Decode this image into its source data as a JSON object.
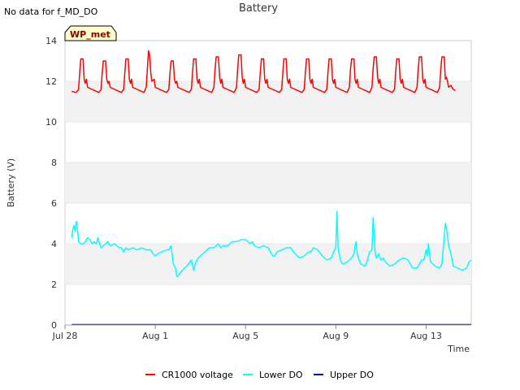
{
  "header": {
    "no_data_note": "No data for f_MD_DO",
    "badge_label": "WP_met"
  },
  "chart_data": {
    "type": "line",
    "title": "Battery",
    "xlabel": "Time",
    "ylabel": "Battery (V)",
    "x_unit": "days",
    "x_range": [
      "Jul 28",
      "Aug 15"
    ],
    "xlim": [
      0,
      18
    ],
    "ylim": [
      0,
      14
    ],
    "y_ticks": [
      0,
      2,
      4,
      6,
      8,
      10,
      12,
      14
    ],
    "x_ticks": [
      {
        "value": 0,
        "label": "Jul 28"
      },
      {
        "value": 4,
        "label": "Aug 1"
      },
      {
        "value": 8,
        "label": "Aug 5"
      },
      {
        "value": 12,
        "label": "Aug 9"
      },
      {
        "value": 16,
        "label": "Aug 13"
      }
    ],
    "grid": "horizontal alternating bands",
    "legend_position": "bottom",
    "series": [
      {
        "name": "CR1000 voltage",
        "color": "#ff0000",
        "points": [
          [
            0.3,
            11.5
          ],
          [
            0.5,
            11.45
          ],
          [
            0.6,
            11.6
          ],
          [
            0.65,
            12.4
          ],
          [
            0.7,
            13.1
          ],
          [
            0.8,
            13.1
          ],
          [
            0.85,
            12.1
          ],
          [
            0.9,
            11.9
          ],
          [
            0.95,
            12.1
          ],
          [
            1.0,
            11.7
          ],
          [
            1.2,
            11.6
          ],
          [
            1.5,
            11.45
          ],
          [
            1.6,
            11.6
          ],
          [
            1.65,
            12.4
          ],
          [
            1.7,
            13.0
          ],
          [
            1.8,
            13.0
          ],
          [
            1.85,
            12.1
          ],
          [
            1.9,
            11.9
          ],
          [
            1.95,
            12.0
          ],
          [
            2.0,
            11.7
          ],
          [
            2.2,
            11.6
          ],
          [
            2.5,
            11.45
          ],
          [
            2.6,
            11.6
          ],
          [
            2.65,
            12.4
          ],
          [
            2.7,
            13.1
          ],
          [
            2.8,
            13.1
          ],
          [
            2.85,
            12.1
          ],
          [
            2.9,
            11.9
          ],
          [
            2.95,
            12.1
          ],
          [
            3.0,
            11.7
          ],
          [
            3.2,
            11.6
          ],
          [
            3.5,
            11.45
          ],
          [
            3.6,
            11.7
          ],
          [
            3.65,
            12.6
          ],
          [
            3.7,
            13.5
          ],
          [
            3.75,
            13.3
          ],
          [
            3.8,
            12.4
          ],
          [
            3.85,
            12.0
          ],
          [
            3.95,
            12.1
          ],
          [
            4.0,
            11.7
          ],
          [
            4.2,
            11.6
          ],
          [
            4.5,
            11.45
          ],
          [
            4.6,
            11.6
          ],
          [
            4.65,
            12.4
          ],
          [
            4.7,
            13.0
          ],
          [
            4.8,
            13.0
          ],
          [
            4.85,
            12.1
          ],
          [
            4.9,
            11.9
          ],
          [
            4.95,
            12.0
          ],
          [
            5.0,
            11.7
          ],
          [
            5.2,
            11.6
          ],
          [
            5.5,
            11.45
          ],
          [
            5.6,
            11.6
          ],
          [
            5.65,
            12.4
          ],
          [
            5.7,
            13.1
          ],
          [
            5.8,
            13.1
          ],
          [
            5.85,
            12.1
          ],
          [
            5.9,
            11.9
          ],
          [
            5.95,
            12.1
          ],
          [
            6.0,
            11.7
          ],
          [
            6.2,
            11.6
          ],
          [
            6.5,
            11.45
          ],
          [
            6.6,
            11.7
          ],
          [
            6.65,
            12.6
          ],
          [
            6.7,
            13.2
          ],
          [
            6.8,
            13.2
          ],
          [
            6.85,
            12.2
          ],
          [
            6.9,
            11.9
          ],
          [
            6.95,
            12.1
          ],
          [
            7.0,
            11.7
          ],
          [
            7.2,
            11.6
          ],
          [
            7.5,
            11.45
          ],
          [
            7.6,
            11.7
          ],
          [
            7.65,
            12.6
          ],
          [
            7.7,
            13.3
          ],
          [
            7.8,
            13.3
          ],
          [
            7.85,
            12.2
          ],
          [
            7.9,
            11.9
          ],
          [
            7.95,
            12.1
          ],
          [
            8.0,
            11.7
          ],
          [
            8.2,
            11.6
          ],
          [
            8.5,
            11.45
          ],
          [
            8.6,
            11.6
          ],
          [
            8.65,
            12.4
          ],
          [
            8.7,
            13.1
          ],
          [
            8.8,
            13.1
          ],
          [
            8.85,
            12.1
          ],
          [
            8.9,
            11.9
          ],
          [
            8.95,
            12.1
          ],
          [
            9.0,
            11.7
          ],
          [
            9.2,
            11.6
          ],
          [
            9.5,
            11.45
          ],
          [
            9.6,
            11.6
          ],
          [
            9.65,
            12.4
          ],
          [
            9.7,
            13.1
          ],
          [
            9.8,
            13.1
          ],
          [
            9.85,
            12.1
          ],
          [
            9.9,
            11.9
          ],
          [
            9.95,
            12.1
          ],
          [
            10.0,
            11.7
          ],
          [
            10.2,
            11.6
          ],
          [
            10.5,
            11.45
          ],
          [
            10.6,
            11.6
          ],
          [
            10.65,
            12.4
          ],
          [
            10.7,
            13.1
          ],
          [
            10.8,
            13.1
          ],
          [
            10.85,
            12.1
          ],
          [
            10.9,
            11.9
          ],
          [
            10.95,
            12.1
          ],
          [
            11.0,
            11.7
          ],
          [
            11.2,
            11.6
          ],
          [
            11.5,
            11.45
          ],
          [
            11.6,
            11.6
          ],
          [
            11.65,
            12.4
          ],
          [
            11.7,
            13.1
          ],
          [
            11.8,
            13.1
          ],
          [
            11.85,
            12.1
          ],
          [
            11.9,
            11.9
          ],
          [
            11.95,
            12.1
          ],
          [
            12.0,
            11.7
          ],
          [
            12.2,
            11.6
          ],
          [
            12.5,
            11.45
          ],
          [
            12.6,
            11.7
          ],
          [
            12.65,
            12.6
          ],
          [
            12.7,
            13.1
          ],
          [
            12.8,
            13.1
          ],
          [
            12.85,
            12.1
          ],
          [
            12.9,
            11.9
          ],
          [
            12.95,
            12.1
          ],
          [
            13.0,
            11.7
          ],
          [
            13.2,
            11.6
          ],
          [
            13.5,
            11.45
          ],
          [
            13.6,
            11.7
          ],
          [
            13.65,
            12.6
          ],
          [
            13.7,
            13.2
          ],
          [
            13.8,
            13.2
          ],
          [
            13.85,
            12.2
          ],
          [
            13.9,
            11.9
          ],
          [
            13.95,
            12.1
          ],
          [
            14.0,
            11.7
          ],
          [
            14.2,
            11.6
          ],
          [
            14.5,
            11.45
          ],
          [
            14.6,
            11.6
          ],
          [
            14.65,
            12.4
          ],
          [
            14.7,
            13.1
          ],
          [
            14.8,
            13.1
          ],
          [
            14.85,
            12.1
          ],
          [
            14.9,
            11.9
          ],
          [
            14.95,
            12.1
          ],
          [
            15.0,
            11.7
          ],
          [
            15.2,
            11.6
          ],
          [
            15.5,
            11.45
          ],
          [
            15.6,
            11.7
          ],
          [
            15.65,
            12.6
          ],
          [
            15.7,
            13.2
          ],
          [
            15.8,
            13.2
          ],
          [
            15.85,
            12.1
          ],
          [
            15.9,
            11.9
          ],
          [
            15.95,
            12.1
          ],
          [
            16.0,
            11.7
          ],
          [
            16.2,
            11.6
          ],
          [
            16.5,
            11.45
          ],
          [
            16.6,
            11.7
          ],
          [
            16.65,
            12.6
          ],
          [
            16.7,
            13.2
          ],
          [
            16.8,
            13.2
          ],
          [
            16.85,
            12.1
          ],
          [
            16.9,
            12.2
          ],
          [
            16.95,
            12.0
          ],
          [
            17.0,
            11.7
          ],
          [
            17.1,
            11.8
          ],
          [
            17.2,
            11.6
          ],
          [
            17.3,
            11.55
          ]
        ]
      },
      {
        "name": "Lower DO",
        "color": "#00ffff",
        "points": [
          [
            0.3,
            4.3
          ],
          [
            0.35,
            4.7
          ],
          [
            0.4,
            4.9
          ],
          [
            0.45,
            4.6
          ],
          [
            0.5,
            5.1
          ],
          [
            0.55,
            4.8
          ],
          [
            0.6,
            4.1
          ],
          [
            0.7,
            4.0
          ],
          [
            0.8,
            4.0
          ],
          [
            0.9,
            4.1
          ],
          [
            1.0,
            4.3
          ],
          [
            1.1,
            4.2
          ],
          [
            1.2,
            4.0
          ],
          [
            1.3,
            4.1
          ],
          [
            1.4,
            4.0
          ],
          [
            1.45,
            4.3
          ],
          [
            1.5,
            4.1
          ],
          [
            1.6,
            3.8
          ],
          [
            1.7,
            3.9
          ],
          [
            1.8,
            4.0
          ],
          [
            1.9,
            4.1
          ],
          [
            2.0,
            3.9
          ],
          [
            2.2,
            4.0
          ],
          [
            2.4,
            3.8
          ],
          [
            2.5,
            3.8
          ],
          [
            2.6,
            3.6
          ],
          [
            2.7,
            3.8
          ],
          [
            2.8,
            3.7
          ],
          [
            3.0,
            3.8
          ],
          [
            3.2,
            3.7
          ],
          [
            3.4,
            3.8
          ],
          [
            3.6,
            3.7
          ],
          [
            3.8,
            3.7
          ],
          [
            3.9,
            3.5
          ],
          [
            4.0,
            3.4
          ],
          [
            4.1,
            3.5
          ],
          [
            4.3,
            3.6
          ],
          [
            4.5,
            3.7
          ],
          [
            4.6,
            3.7
          ],
          [
            4.7,
            3.9
          ],
          [
            4.75,
            3.5
          ],
          [
            4.8,
            3.0
          ],
          [
            4.9,
            2.8
          ],
          [
            4.95,
            2.4
          ],
          [
            5.0,
            2.4
          ],
          [
            5.2,
            2.7
          ],
          [
            5.4,
            2.9
          ],
          [
            5.6,
            3.2
          ],
          [
            5.7,
            2.7
          ],
          [
            5.8,
            3.1
          ],
          [
            5.9,
            3.3
          ],
          [
            6.0,
            3.4
          ],
          [
            6.2,
            3.6
          ],
          [
            6.4,
            3.8
          ],
          [
            6.6,
            3.8
          ],
          [
            6.8,
            4.0
          ],
          [
            6.9,
            3.8
          ],
          [
            7.0,
            3.9
          ],
          [
            7.2,
            3.9
          ],
          [
            7.3,
            4.0
          ],
          [
            7.4,
            4.1
          ],
          [
            7.6,
            4.1
          ],
          [
            7.8,
            4.2
          ],
          [
            8.0,
            4.2
          ],
          [
            8.2,
            4.0
          ],
          [
            8.3,
            4.1
          ],
          [
            8.4,
            3.9
          ],
          [
            8.6,
            3.8
          ],
          [
            8.8,
            3.9
          ],
          [
            9.0,
            3.8
          ],
          [
            9.2,
            3.4
          ],
          [
            9.3,
            3.4
          ],
          [
            9.4,
            3.6
          ],
          [
            9.6,
            3.7
          ],
          [
            9.8,
            3.8
          ],
          [
            10.0,
            3.8
          ],
          [
            10.2,
            3.5
          ],
          [
            10.4,
            3.3
          ],
          [
            10.6,
            3.4
          ],
          [
            10.8,
            3.6
          ],
          [
            10.9,
            3.6
          ],
          [
            11.0,
            3.8
          ],
          [
            11.2,
            3.7
          ],
          [
            11.4,
            3.4
          ],
          [
            11.6,
            3.2
          ],
          [
            11.8,
            3.3
          ],
          [
            11.9,
            3.6
          ],
          [
            12.0,
            3.8
          ],
          [
            12.05,
            5.6
          ],
          [
            12.1,
            3.8
          ],
          [
            12.2,
            3.2
          ],
          [
            12.3,
            3.0
          ],
          [
            12.5,
            3.1
          ],
          [
            12.6,
            3.2
          ],
          [
            12.7,
            3.3
          ],
          [
            12.8,
            3.5
          ],
          [
            12.85,
            3.9
          ],
          [
            12.9,
            4.1
          ],
          [
            12.95,
            3.5
          ],
          [
            13.0,
            3.3
          ],
          [
            13.1,
            3.0
          ],
          [
            13.3,
            2.9
          ],
          [
            13.4,
            3.2
          ],
          [
            13.5,
            3.6
          ],
          [
            13.6,
            3.7
          ],
          [
            13.65,
            5.3
          ],
          [
            13.7,
            4.4
          ],
          [
            13.75,
            3.5
          ],
          [
            13.8,
            3.3
          ],
          [
            13.9,
            3.5
          ],
          [
            14.0,
            3.2
          ],
          [
            14.1,
            3.3
          ],
          [
            14.2,
            3.1
          ],
          [
            14.4,
            2.9
          ],
          [
            14.6,
            3.0
          ],
          [
            14.8,
            3.2
          ],
          [
            15.0,
            3.3
          ],
          [
            15.2,
            3.2
          ],
          [
            15.4,
            2.8
          ],
          [
            15.6,
            2.8
          ],
          [
            15.8,
            3.2
          ],
          [
            15.9,
            3.2
          ],
          [
            16.0,
            3.7
          ],
          [
            16.05,
            3.4
          ],
          [
            16.1,
            4.0
          ],
          [
            16.2,
            3.1
          ],
          [
            16.4,
            2.9
          ],
          [
            16.6,
            2.8
          ],
          [
            16.7,
            3.0
          ],
          [
            16.8,
            4.3
          ],
          [
            16.85,
            5.0
          ],
          [
            16.9,
            4.8
          ],
          [
            17.0,
            3.9
          ],
          [
            17.1,
            3.5
          ],
          [
            17.2,
            2.9
          ],
          [
            17.4,
            2.8
          ],
          [
            17.6,
            2.7
          ],
          [
            17.8,
            2.8
          ],
          [
            17.9,
            3.1
          ],
          [
            18.0,
            3.2
          ]
        ]
      },
      {
        "name": "Upper DO",
        "color": "#00008b",
        "points": [
          [
            0.3,
            0.02
          ],
          [
            18.0,
            0.02
          ]
        ]
      }
    ]
  }
}
